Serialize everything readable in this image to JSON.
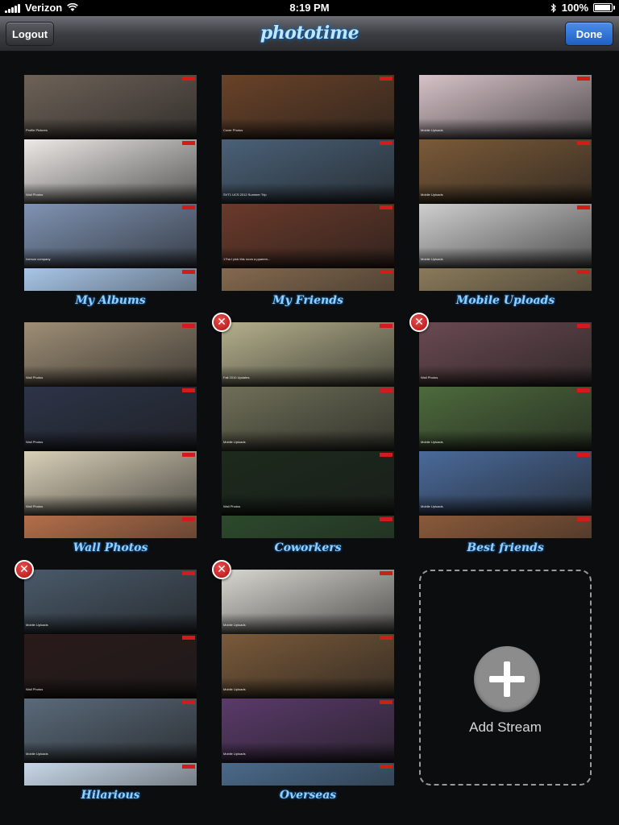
{
  "status_bar": {
    "carrier": "Verizon",
    "time": "8:19 PM",
    "battery": "100%",
    "battery_level": 1.0
  },
  "nav": {
    "logout_label": "Logout",
    "logo_text": "phototime",
    "done_label": "Done"
  },
  "streams": [
    {
      "title": "My Albums",
      "deletable": false,
      "tiles": [
        {
          "caption": "Profile Pictures"
        },
        {
          "caption": "Wall Photos"
        },
        {
          "caption": "Iverson company"
        },
        {
          "caption": ""
        }
      ]
    },
    {
      "title": "My Friends",
      "deletable": false,
      "tiles": [
        {
          "caption": "Cover Photos"
        },
        {
          "caption": "SVT1 UCS 2012 Summer Trip"
        },
        {
          "caption": "17ha I pick this room a pparem..."
        },
        {
          "caption": ""
        }
      ]
    },
    {
      "title": "Mobile Uploads",
      "deletable": false,
      "tiles": [
        {
          "caption": "Mobile Uploads"
        },
        {
          "caption": "Mobile Uploads"
        },
        {
          "caption": "Mobile Uploads"
        },
        {
          "caption": ""
        }
      ]
    },
    {
      "title": "Wall Photos",
      "deletable": false,
      "tiles": [
        {
          "caption": "Wall Photos"
        },
        {
          "caption": "Wall Photos"
        },
        {
          "caption": "Wall Photos"
        },
        {
          "caption": ""
        }
      ]
    },
    {
      "title": "Coworkers",
      "deletable": true,
      "tiles": [
        {
          "caption": "Fall 2010 Updates"
        },
        {
          "caption": "Mobile Uploads"
        },
        {
          "caption": "Wall Photos"
        },
        {
          "caption": ""
        }
      ]
    },
    {
      "title": "Best friends",
      "deletable": true,
      "tiles": [
        {
          "caption": "Wall Photos"
        },
        {
          "caption": "Mobile Uploads"
        },
        {
          "caption": "Mobile Uploads"
        },
        {
          "caption": ""
        }
      ]
    },
    {
      "title": "Hilarious",
      "deletable": true,
      "tiles": [
        {
          "caption": "Mobile Uploads"
        },
        {
          "caption": "Wall Photos"
        },
        {
          "caption": "Mobile Uploads"
        },
        {
          "caption": ""
        }
      ]
    },
    {
      "title": "Overseas",
      "deletable": true,
      "tiles": [
        {
          "caption": "Mobile Uploads"
        },
        {
          "caption": "Mobile Uploads"
        },
        {
          "caption": "Mobile Uploads"
        },
        {
          "caption": ""
        }
      ]
    }
  ],
  "add_stream": {
    "label": "Add Stream"
  },
  "colors": {
    "accent": "#1f5fc4",
    "title_blue": "#8fd0ff",
    "delete_red": "#c01818"
  }
}
